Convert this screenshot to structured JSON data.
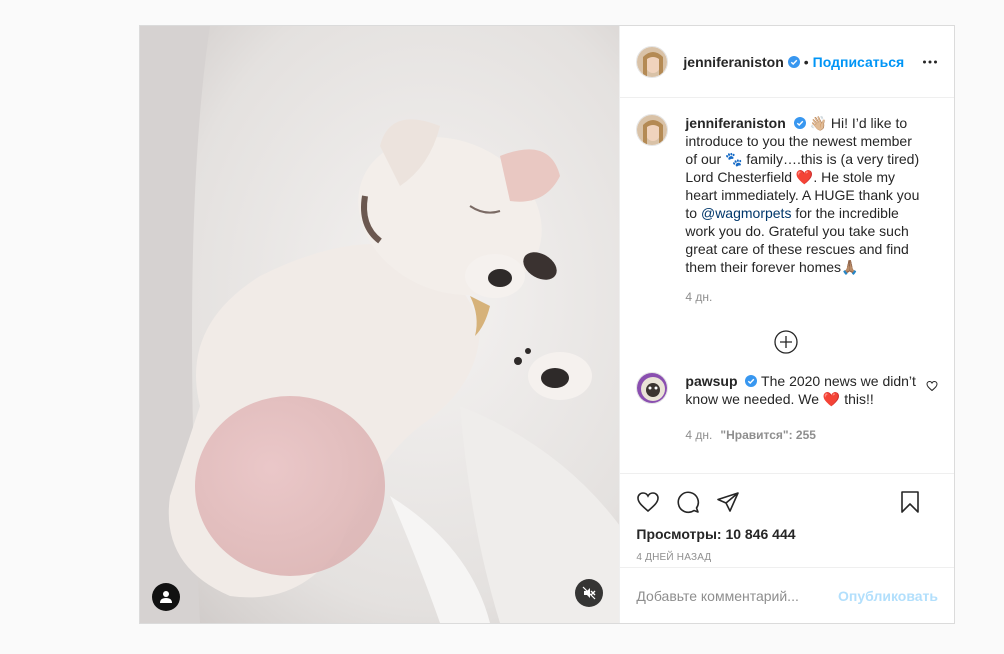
{
  "post": {
    "author": "jenniferaniston",
    "follow_label": "Подписаться",
    "separator": "•",
    "caption_author": "jenniferaniston",
    "caption_parts": {
      "p1": " 👋🏼 Hi! I’d like to introduce to you the newest member of our 🐾 family….this is (a very tired) Lord Chesterfield ❤️. He stole my heart immediately. A HUGE thank you to ",
      "mention": "@wagmorpets",
      "p2": " for the incredible work you do. Grateful you take such great care of these rescues and find them their forever homes🙏🏽"
    },
    "caption_time": "4 дн.",
    "comments": [
      {
        "author": "pawsup",
        "text": " The 2020 news we didn’t know we needed. We ❤️ this!!",
        "time": "4 дн.",
        "likes": "\"Нравится\": 255"
      }
    ],
    "views_label": "Просмотры: 10 846 444",
    "time_ago": "4 ДНЕЙ НАЗАД",
    "comment_placeholder": "Добавьте комментарий...",
    "publish_label": "Опубликовать"
  },
  "colors": {
    "accent": "#0095f6",
    "verified": "#3897f0",
    "heart": "#ed4956"
  },
  "icons": [
    "user-tag-icon",
    "mute-icon",
    "more-icon",
    "verified-icon",
    "load-more-icon",
    "heart-icon",
    "comment-icon",
    "share-icon",
    "save-icon"
  ]
}
